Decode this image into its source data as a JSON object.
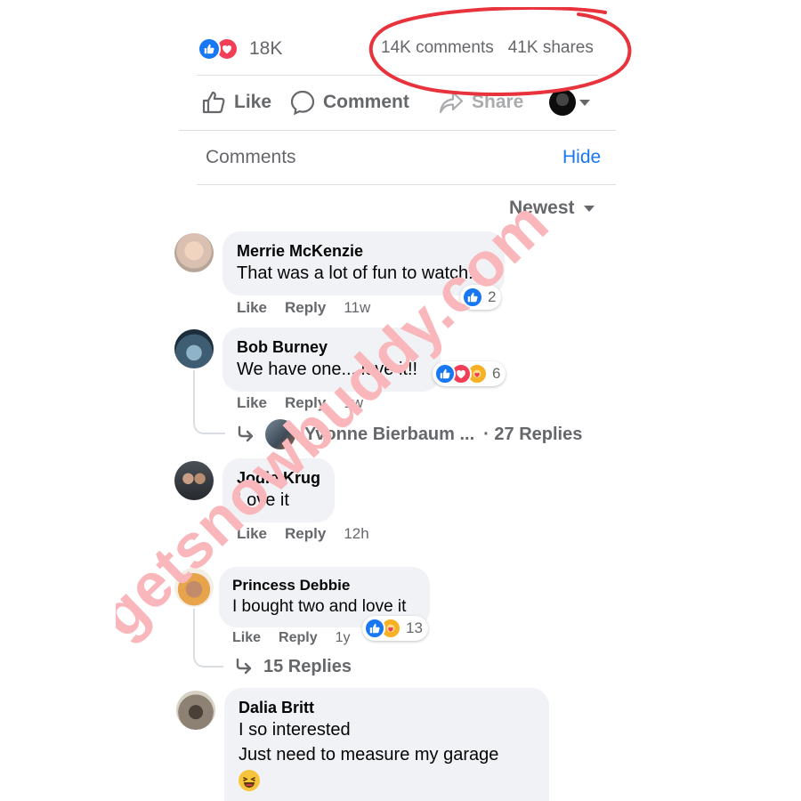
{
  "post_stats": {
    "reaction_count": "18K",
    "comments_count": "14K comments",
    "shares_count": "41K shares",
    "reaction_icons": [
      "like-icon",
      "love-icon"
    ]
  },
  "actions": {
    "like": "Like",
    "comment": "Comment",
    "share": "Share"
  },
  "comments_header": {
    "title": "Comments",
    "hide": "Hide",
    "sort": "Newest"
  },
  "comments": [
    {
      "author": "Merrie McKenzie",
      "text": "That was a lot of fun to watch!",
      "like": "Like",
      "reply": "Reply",
      "time": "11w",
      "reactions": [
        "like-icon"
      ],
      "reaction_count": "2"
    },
    {
      "author": "Bob Burney",
      "text": "We have one... love it!!",
      "like": "Like",
      "reply": "Reply",
      "time": "1w",
      "reactions": [
        "like-icon",
        "love-icon",
        "care-icon"
      ],
      "reaction_count": "6",
      "reply_preview_author": "Yvonne Bierbaum ...",
      "replies_label": "· 27 Replies"
    },
    {
      "author": "Jodie Krug",
      "text": "Love it",
      "like": "Like",
      "reply": "Reply",
      "time": "12h"
    },
    {
      "author": "Princess Debbie",
      "text": "I bought two and love it",
      "like": "Like",
      "reply": "Reply",
      "time": "1y",
      "reactions": [
        "like-icon",
        "care-icon"
      ],
      "reaction_count": "13",
      "replies_label": "15 Replies"
    },
    {
      "author": "Dalia Britt",
      "text_line1": "I so interested",
      "text_line2": "Just need to measure my garage",
      "emoji": "laughing-emoji-icon"
    }
  ],
  "watermark": "getsnowbuddy.com",
  "colors": {
    "facebook_blue": "#1877f2",
    "love_red": "#f33e58",
    "care_yellow": "#f7b125",
    "muted_text": "#65676b",
    "bubble_bg": "#f0f2f5",
    "annotation_red": "#e8323c",
    "watermark_pink": "#f9b7bb"
  }
}
